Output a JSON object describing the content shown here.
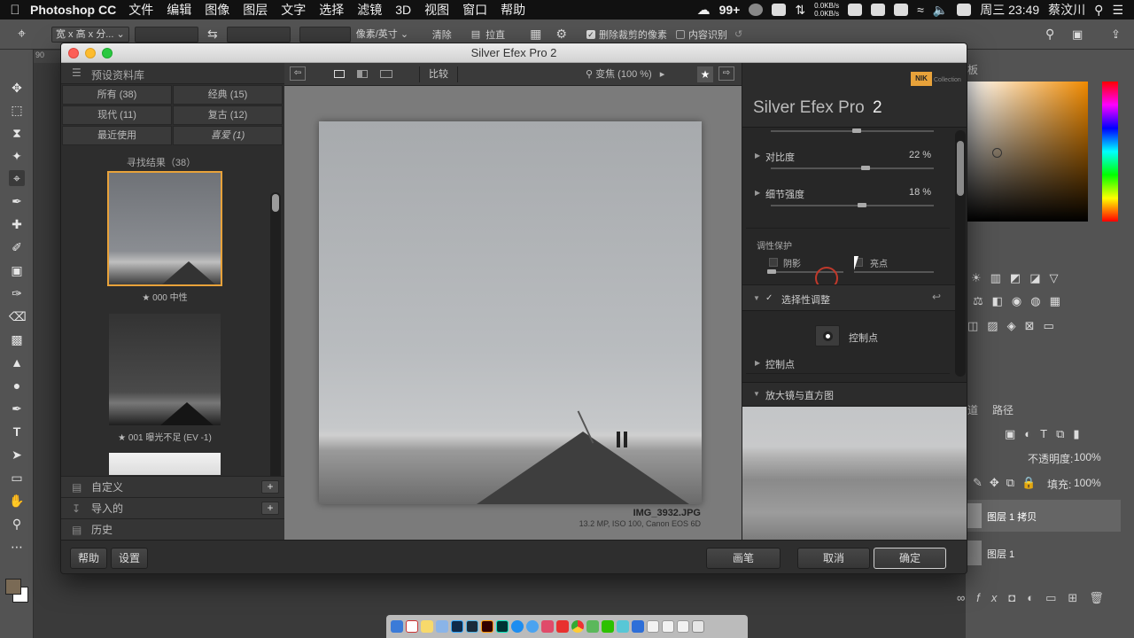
{
  "menubar": {
    "app_name": "Photoshop CC",
    "menus": [
      "文件",
      "编辑",
      "图像",
      "图层",
      "文字",
      "选择",
      "滤镜",
      "3D",
      "视图",
      "窗口",
      "帮助"
    ],
    "badge_99": "99+",
    "net_up": "0.0KB/s",
    "net_down": "0.0KB/s",
    "clock": "周三 23:49",
    "user": "蔡汶川"
  },
  "optbar": {
    "ratio_select": "宽 x 高 x 分...",
    "unit_select": "像素/英寸",
    "clear_label": "清除",
    "straighten_label": "拉直",
    "delete_cropped_label": "删除裁剪的像素",
    "content_aware_label": "内容识别",
    "ruler_mark": "90"
  },
  "dialog": {
    "title": "Silver Efex Pro 2",
    "library": {
      "header": "预设资料库",
      "filters": [
        {
          "label": "所有 (38)"
        },
        {
          "label": "经典 (15)"
        },
        {
          "label": "现代 (11)"
        },
        {
          "label": "复古 (12)"
        },
        {
          "label": "最近使用"
        },
        {
          "label": "喜爱 (1)"
        }
      ],
      "results_label": "寻找结果（38）",
      "thumbs": [
        {
          "caption": "★ 000 中性"
        },
        {
          "caption": "★ 001 曝光不足 (EV -1)"
        }
      ],
      "sections": [
        {
          "label": "自定义"
        },
        {
          "label": "导入的"
        },
        {
          "label": "历史"
        }
      ]
    },
    "viewbar": {
      "compare_label": "比较",
      "zoom_label": "变焦 (100 %)"
    },
    "image": {
      "filename": "IMG_3932.JPG",
      "meta": "13.2 MP, ISO 100, Canon EOS 6D"
    },
    "controls": {
      "brand": "NIK",
      "brand_sub": "Collection",
      "product": "Silver Efex Pro",
      "version": "2",
      "contrast_label": "对比度",
      "contrast_value": "22 %",
      "contrast_level": 0.22,
      "structure_label": "细节强度",
      "structure_value": "18 %",
      "structure_level": 0.18,
      "tonality_label": "调性保护",
      "shadow_label": "阴影",
      "highlight_label": "亮点",
      "selective_label": "选择性调整",
      "control_point_label": "控制点",
      "control_points_section": "控制点",
      "loupe_label": "放大镜与直方图"
    },
    "buttons": {
      "help": "帮助",
      "settings": "设置",
      "brush": "画笔",
      "cancel": "取消",
      "ok": "确定"
    }
  },
  "right_panel": {
    "swatch_tab": "板",
    "channels_tab": "道",
    "paths_tab": "路径",
    "opacity_label": "不透明度:",
    "opacity_value": "100%",
    "fill_label": "填充:",
    "fill_value": "100%",
    "layers": [
      {
        "name": "图层 1 拷贝"
      },
      {
        "name": "图层 1"
      }
    ]
  },
  "colors": {
    "accent_orange": "#e8a23a",
    "ok_border": "#d0d0d0"
  }
}
